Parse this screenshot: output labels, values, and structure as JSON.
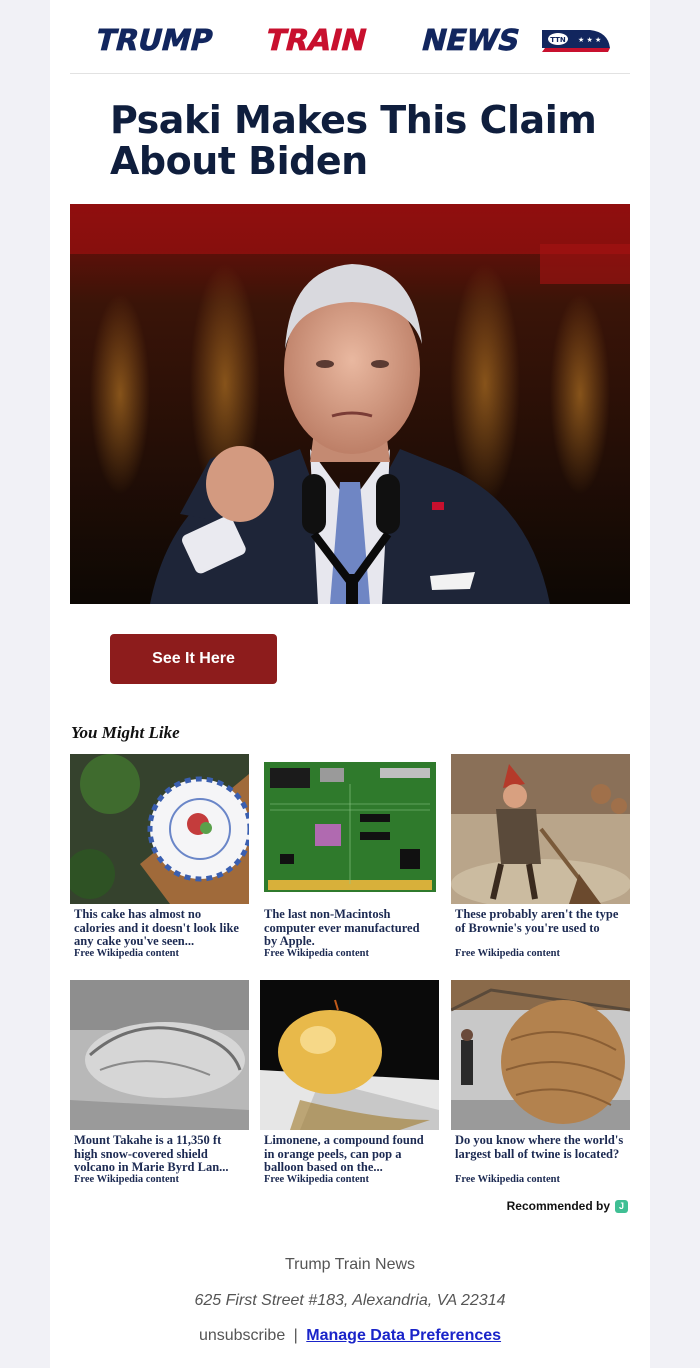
{
  "header": {
    "logo_text": "TRUMPTRAINNEWS",
    "logo_part_1": "TRUMP",
    "logo_part_2": "TRAIN",
    "logo_part_3": "NEWS",
    "logo_badge": "TTN"
  },
  "article": {
    "headline": "Psaki Makes This Claim About Biden",
    "cta_label": "See It Here"
  },
  "recommendations": {
    "heading": "You Might Like",
    "items": [
      {
        "caption": "This cake has almost no calories and it doesn't look like any cake you've seen...",
        "source": "Free Wikipedia content",
        "thumb_icon": "plated-dessert-photo"
      },
      {
        "caption": "The last non-Macintosh computer ever manufactured by Apple.",
        "source": "Free Wikipedia content",
        "thumb_icon": "circuit-board-photo"
      },
      {
        "caption": "These probably aren't the type of Brownie's you're used to",
        "source": "Free Wikipedia content",
        "thumb_icon": "brownie-illustration"
      },
      {
        "caption": "Mount Takahe is a 11,350 ft high snow-covered shield volcano in Marie Byrd Lan...",
        "source": "Free Wikipedia content",
        "thumb_icon": "aerial-volcano-photo"
      },
      {
        "caption": "Limonene, a compound found in orange peels, can pop a balloon based on the...",
        "source": "Free Wikipedia content",
        "thumb_icon": "balloon-photo"
      },
      {
        "caption": "Do you know where the world's largest ball of twine is located?",
        "source": "Free Wikipedia content",
        "thumb_icon": "twine-ball-photo"
      }
    ],
    "recommended_by": "Recommended by",
    "badge_letter": "J"
  },
  "footer": {
    "company": "Trump Train News",
    "address": "625 First Street #183, Alexandria, VA 22314",
    "unsubscribe": "unsubscribe",
    "separator": "|",
    "manage": "Manage Data Preferences"
  },
  "colors": {
    "page_bg": "#f1f1f6",
    "headline": "#0f1e3d",
    "cta_bg": "#8d1c1c",
    "logo_navy": "#12265e",
    "logo_red": "#c8102e",
    "link": "#1a24c9",
    "caption": "#1c2a52"
  }
}
